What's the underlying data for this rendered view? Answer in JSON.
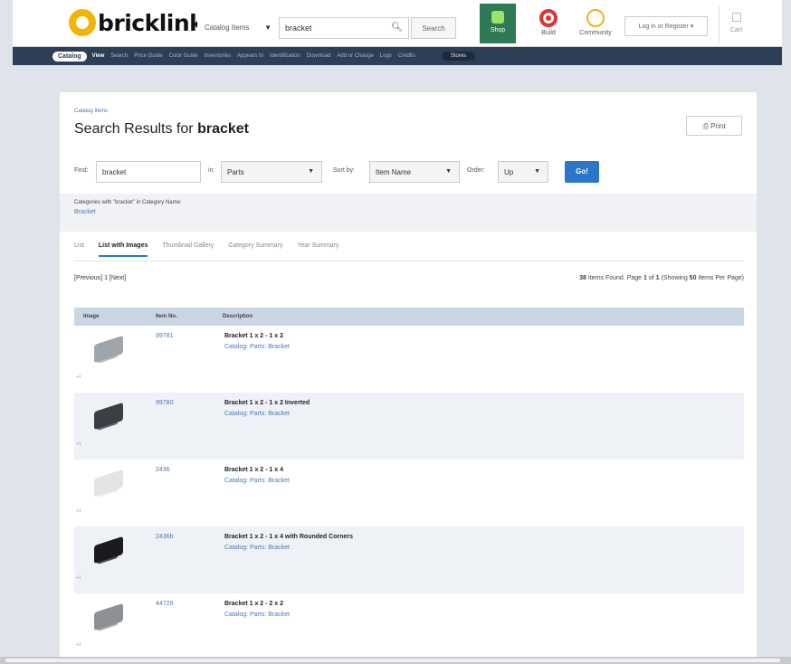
{
  "header": {
    "logo": "bricklink",
    "search_type": "Catalog Items",
    "search_value": "bracket",
    "search_button": "Search",
    "shop": "Shop",
    "build": "Build",
    "community": "Community",
    "login": "Log in or Register",
    "cart": "Cart"
  },
  "subnav": {
    "catalog": "Catalog",
    "items": [
      "View",
      "Search",
      "Price Guide",
      "Color Guide",
      "Inventories",
      "Appears In",
      "Identification",
      "Download",
      "Add or Change",
      "Logs",
      "Credits"
    ],
    "stores": "Stores"
  },
  "page": {
    "breadcrumb": "Catalog Items",
    "title_prefix": "Search Results for",
    "title_query": "bracket",
    "print": "Print"
  },
  "filters": {
    "find_label": "Find:",
    "find_value": "bracket",
    "in_label": "in:",
    "in_value": "Parts",
    "sort_label": "Sort by:",
    "sort_value": "Item Name",
    "order_label": "Order:",
    "order_value": "Up",
    "go": "Go!"
  },
  "categories": {
    "title": "Categories with \"bracket\" in Category Name:",
    "link": "Bracket"
  },
  "tabs": [
    "List",
    "List with Images",
    "Thumbnail Gallery",
    "Category Summary",
    "Year Summary"
  ],
  "active_tab": "List with Images",
  "pager": "[Previous] 1 [Next]",
  "found": {
    "count": "38",
    "text_a": "Items Found. Page",
    "page": "1",
    "text_b": "of",
    "pages": "1",
    "text_c": "(Showing",
    "per_page": "50",
    "text_d": "Items Per Page)"
  },
  "table": {
    "headers": [
      "Image",
      "Item No.",
      "Description"
    ],
    "zoom_label": "+1",
    "rows": [
      {
        "item_no": "99781",
        "description": "Bracket 1 x 2 - 1 x 2",
        "category": "Catalog: Parts: Bracket",
        "color": "#a0a5a9"
      },
      {
        "item_no": "99780",
        "description": "Bracket 1 x 2 - 1 x 2 Inverted",
        "category": "Catalog: Parts: Bracket",
        "color": "#3b3e43"
      },
      {
        "item_no": "2436",
        "description": "Bracket 1 x 2 - 1 x 4",
        "category": "Catalog: Parts: Bracket",
        "color": "#e4e4e2"
      },
      {
        "item_no": "2436b",
        "description": "Bracket 1 x 2 - 1 x 4 with Rounded Corners",
        "category": "Catalog: Parts: Bracket",
        "color": "#1b1b1d"
      },
      {
        "item_no": "44728",
        "description": "Bracket 1 x 2 - 2 x 2",
        "category": "Catalog: Parts: Bracket",
        "color": "#8c9196"
      }
    ]
  }
}
